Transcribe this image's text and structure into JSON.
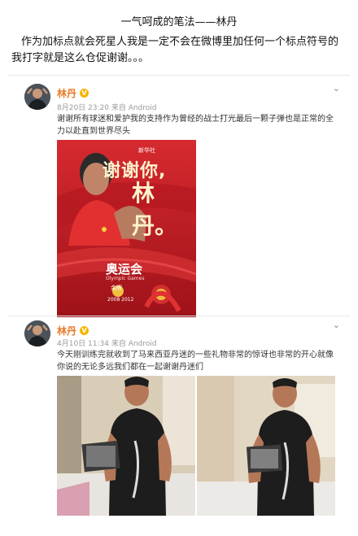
{
  "headline": "一气呵成的笔法——林丹",
  "intro": "作为加标点就会死星人我是一定不会在微博里加任何一个标点符号的我打字就是这么仓促谢谢。。。",
  "posts": [
    {
      "author": "林丹",
      "verified_mark": "V",
      "meta": "8月20日 23:20 来自 Android",
      "text": "谢谢所有球迷和爱护我的支持作为曾经的战士打光最后一颗子弹也是正常的全力以赴直到世界尽头",
      "poster": {
        "big_text_1": "谢谢你,",
        "big_text_2": "林丹。",
        "event": "奥运会",
        "event_sub": "Olympic Games",
        "medal": "金牌",
        "years": "2008   2012",
        "logo": "新华社"
      }
    },
    {
      "author": "林丹",
      "verified_mark": "V",
      "meta": "4月10日 11:34 来自 Android",
      "text": "今天刚训练完就收到了马来西亚丹迷的一些礼物非常的惊讶也非常的开心就像你说的无论多远我们都在一起谢谢丹迷们"
    }
  ],
  "icons": {
    "chevron": "chevron-down-icon"
  },
  "colors": {
    "author": "#e87b2c",
    "verified": "#f7b500",
    "poster_red": "#c8202a"
  }
}
